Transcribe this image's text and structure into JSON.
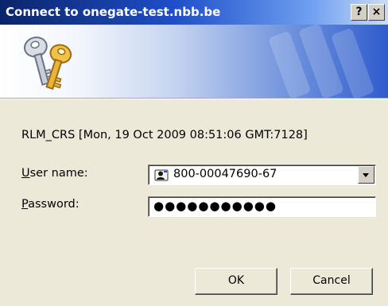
{
  "window": {
    "title": "Connect to onegate-test.nbb.be",
    "help_label": "?",
    "close_label": "×"
  },
  "dialog": {
    "realm_text": "RLM_CRS [Mon, 19 Oct 2009 08:51:06 GMT:7128]",
    "username_label_access": "U",
    "username_label_rest": "ser name:",
    "username_value": "800-00047690-67",
    "password_label_access": "P",
    "password_label_rest": "assword:",
    "password_masked": "●●●●●●●●●●●"
  },
  "buttons": {
    "ok_label": "OK",
    "cancel_label": "Cancel"
  },
  "icons": {
    "banner": "keys-icon",
    "user": "user-card-icon",
    "dropdown": "chevron-down-icon"
  },
  "colors": {
    "titlebar_start": "#0a246a",
    "titlebar_end": "#c9ddf5",
    "dialog_bg": "#ece9d8"
  }
}
